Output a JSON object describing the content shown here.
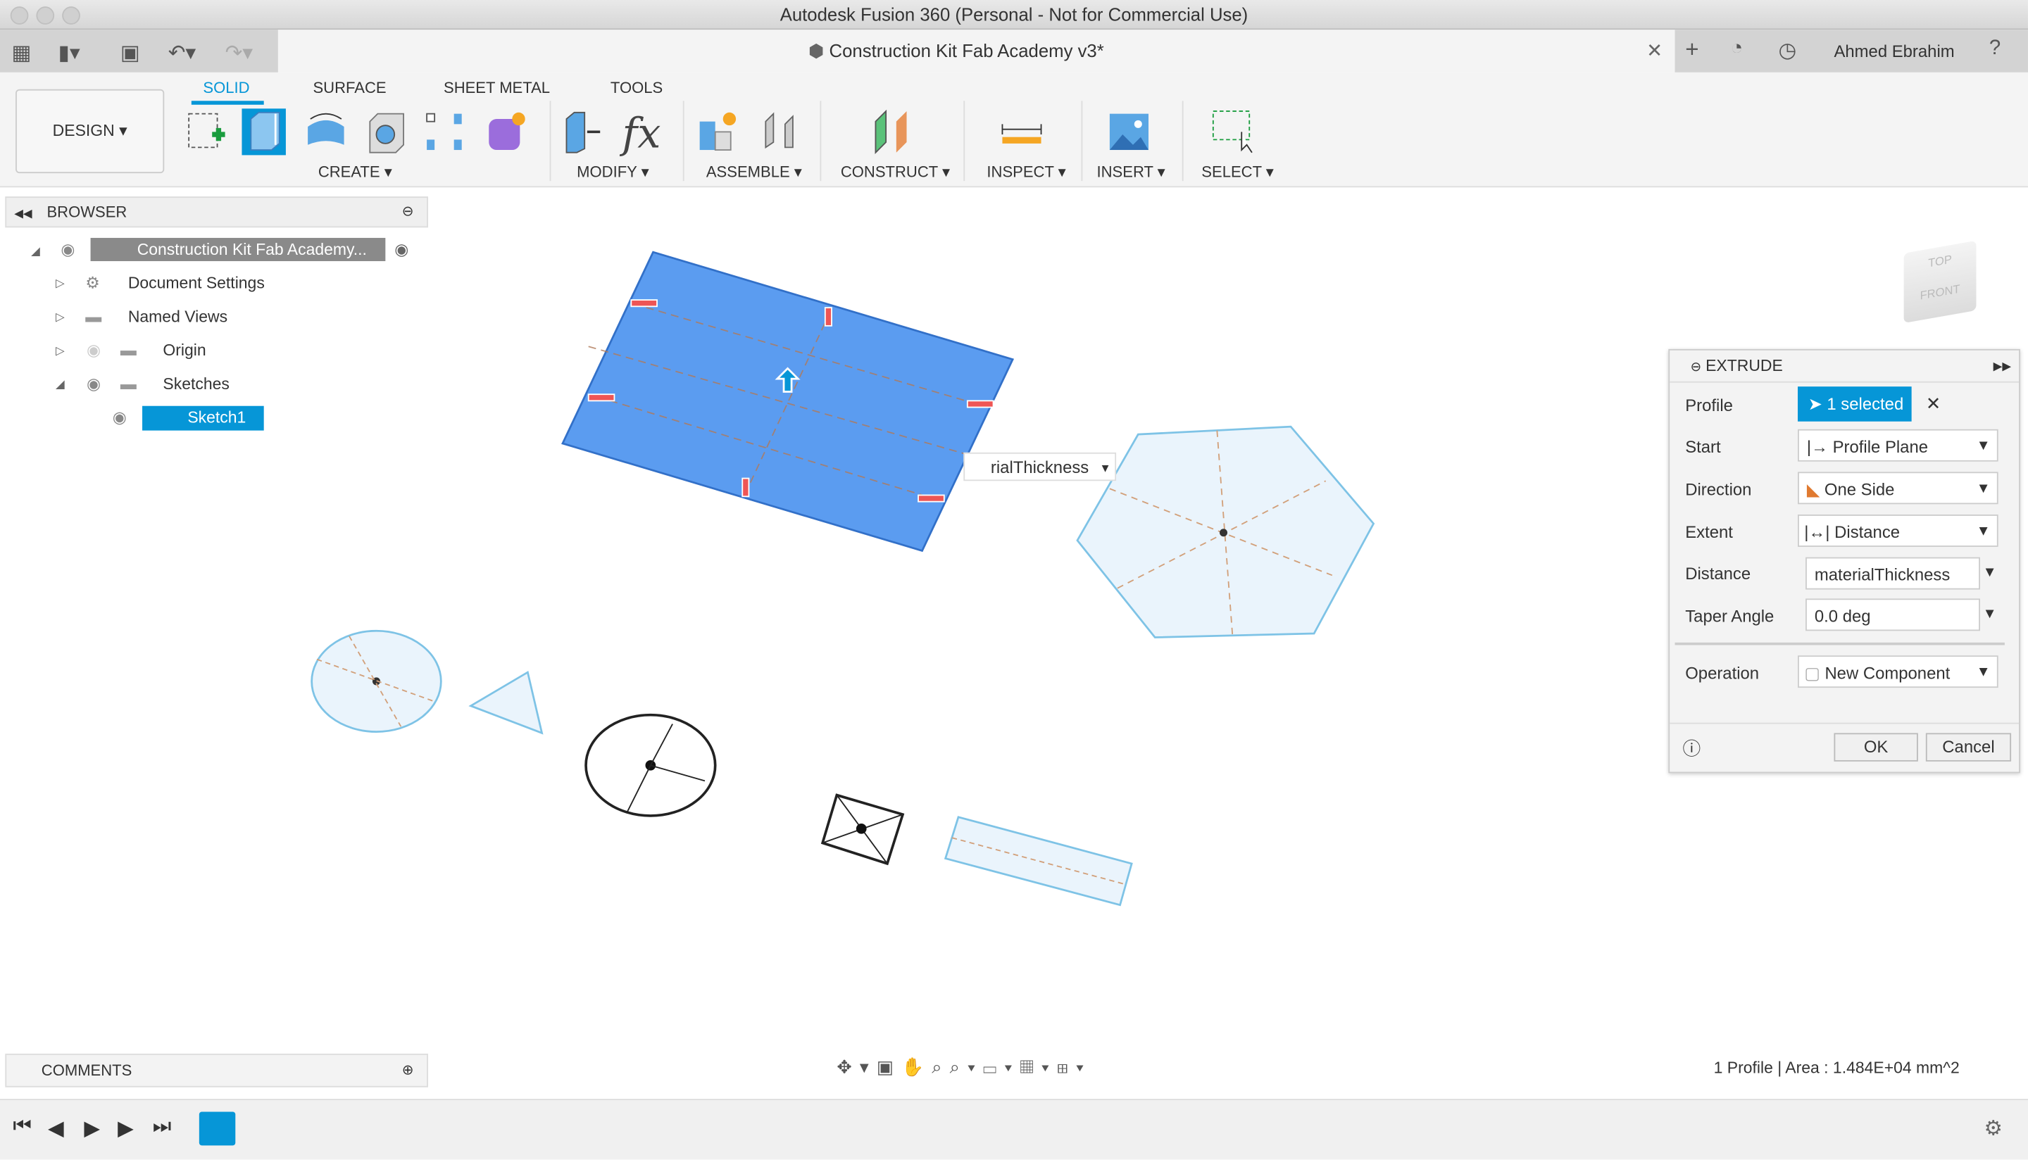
{
  "window": {
    "title": "Autodesk Fusion 360 (Personal - Not for Commercial Use)"
  },
  "document_tab": {
    "title": "Construction Kit Fab Academy v3*"
  },
  "user": {
    "name": "Ahmed Ebrahim"
  },
  "workspace": {
    "label": "DESIGN"
  },
  "ribbon": {
    "tabs": [
      {
        "label": "SOLID",
        "active": true
      },
      {
        "label": "SURFACE"
      },
      {
        "label": "SHEET METAL"
      },
      {
        "label": "TOOLS"
      }
    ],
    "groups": [
      "CREATE",
      "MODIFY",
      "ASSEMBLE",
      "CONSTRUCT",
      "INSPECT",
      "INSERT",
      "SELECT"
    ],
    "accent": "#0696d7"
  },
  "browser": {
    "title": "BROWSER",
    "items": [
      {
        "label": "Construction Kit Fab Academy..."
      },
      {
        "label": "Document Settings"
      },
      {
        "label": "Named Views"
      },
      {
        "label": "Origin"
      },
      {
        "label": "Sketches"
      },
      {
        "label": "Sketch1",
        "selected": true
      }
    ]
  },
  "viewport": {
    "distance_tag": "rialThickness",
    "viewcube": {
      "top": "TOP",
      "front": "FRONT"
    }
  },
  "extrude": {
    "title": "EXTRUDE",
    "profile": {
      "label": "Profile",
      "value": "1 selected"
    },
    "start": {
      "label": "Start",
      "value": "Profile Plane"
    },
    "direction": {
      "label": "Direction",
      "value": "One Side"
    },
    "extent": {
      "label": "Extent",
      "value": "Distance"
    },
    "distance": {
      "label": "Distance",
      "value": "materialThickness"
    },
    "taper": {
      "label": "Taper Angle",
      "value": "0.0 deg"
    },
    "operation": {
      "label": "Operation",
      "value": "New Component"
    },
    "ok": "OK",
    "cancel": "Cancel"
  },
  "comments": {
    "title": "COMMENTS"
  },
  "status": {
    "text": "1 Profile | Area : 1.484E+04 mm^2"
  }
}
